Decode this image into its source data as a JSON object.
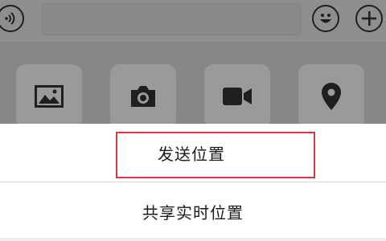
{
  "input_bar": {
    "voice_icon": "voice-icon",
    "emoji_icon": "emoji-icon",
    "plus_icon": "plus-icon"
  },
  "attachment_panel": {
    "items": [
      {
        "icon": "image-icon"
      },
      {
        "icon": "camera-icon"
      },
      {
        "icon": "video-icon"
      },
      {
        "icon": "location-pin-icon"
      }
    ]
  },
  "action_sheet": {
    "send_location": "发送位置",
    "share_live_location": "共享实时位置",
    "highlight_color": "#d8383d"
  },
  "colors": {
    "overlay_gray": "#8b8b8b",
    "sheet_bg": "#ffffff",
    "icon_dark": "#1f1f1f"
  }
}
